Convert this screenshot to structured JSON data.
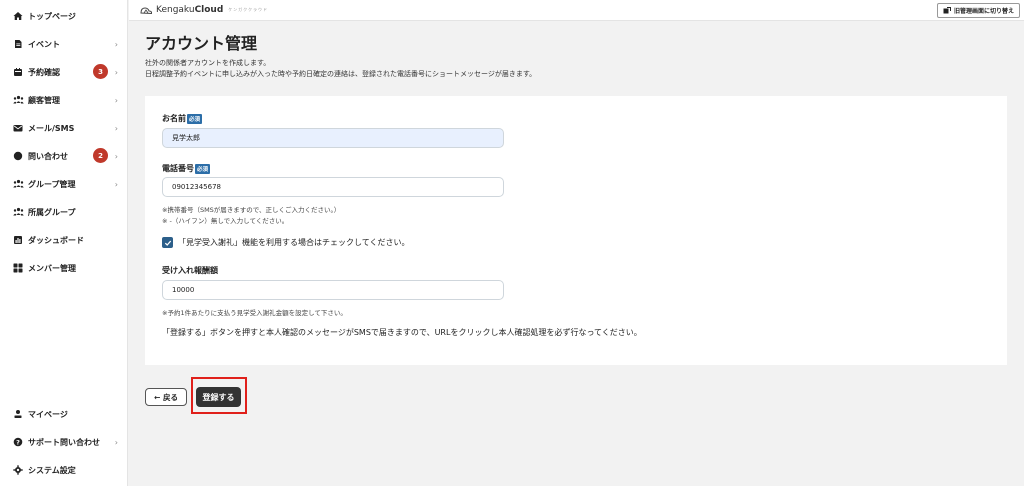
{
  "sidebar": {
    "items": [
      {
        "label": "トップページ",
        "icon": "home-icon"
      },
      {
        "label": "イベント",
        "icon": "document-icon",
        "chevron": "›"
      },
      {
        "label": "予約確認",
        "icon": "calendar-icon",
        "badge": "3",
        "chevron": "›"
      },
      {
        "label": "顧客管理",
        "icon": "users-icon",
        "chevron": "›"
      },
      {
        "label": "メール/SMS",
        "icon": "mail-icon",
        "chevron": "›"
      },
      {
        "label": "問い合わせ",
        "icon": "chat-icon",
        "badge": "2",
        "chevron": "›"
      },
      {
        "label": "グループ管理",
        "icon": "group-icon",
        "chevron": "›"
      },
      {
        "label": "所属グループ",
        "icon": "affiliation-icon"
      },
      {
        "label": "ダッシュボード",
        "icon": "dashboard-icon"
      },
      {
        "label": "メンバー管理",
        "icon": "grid-icon"
      }
    ],
    "bottom": [
      {
        "label": "マイページ",
        "icon": "person-icon"
      },
      {
        "label": "サポート問い合わせ",
        "icon": "help-icon",
        "chevron": "›"
      },
      {
        "label": "システム設定",
        "icon": "gear-icon"
      }
    ]
  },
  "header": {
    "brand_light": "Kengaku",
    "brand_bold": "Cloud",
    "brand_sub": "ケンガククラウド",
    "switch_label": "旧管理画面に切り替え"
  },
  "main": {
    "title": "アカウント管理",
    "description_1": "社外の関係者アカウントを作成します。",
    "description_2": "日程調整予約イベントに申し込みが入った時や予約日確定の連絡は、登録された電話番号にショートメッセージが届きます。",
    "required_badge": "必須",
    "name": {
      "label": "お名前",
      "value": "見学太郎"
    },
    "phone": {
      "label": "電話番号",
      "value": "09012345678",
      "note_1": "※携帯番号（SMSが届きますので、正しくご入力ください。）",
      "note_2": "※ -（ハイフン）無しで入力してください。"
    },
    "checkbox_label": "「見学受入謝礼」機能を利用する場合はチェックしてください。",
    "checkbox_checked": true,
    "reward": {
      "label": "受け入れ報酬額",
      "value": "10000",
      "note": "※予約1件あたりに支払う見学受入謝礼金額を設定して下さい。"
    },
    "info": "「登録する」ボタンを押すと本人確認のメッセージがSMSで届きますので、URLをクリックし本人確認処理を必ず行なってください。"
  },
  "actions": {
    "back_label": "← 戻る",
    "register_label": "登録する"
  },
  "colors": {
    "accent": "#2c5f8a",
    "badge": "#c0392b",
    "highlight": "#e0201b",
    "primary_button": "#333333"
  }
}
